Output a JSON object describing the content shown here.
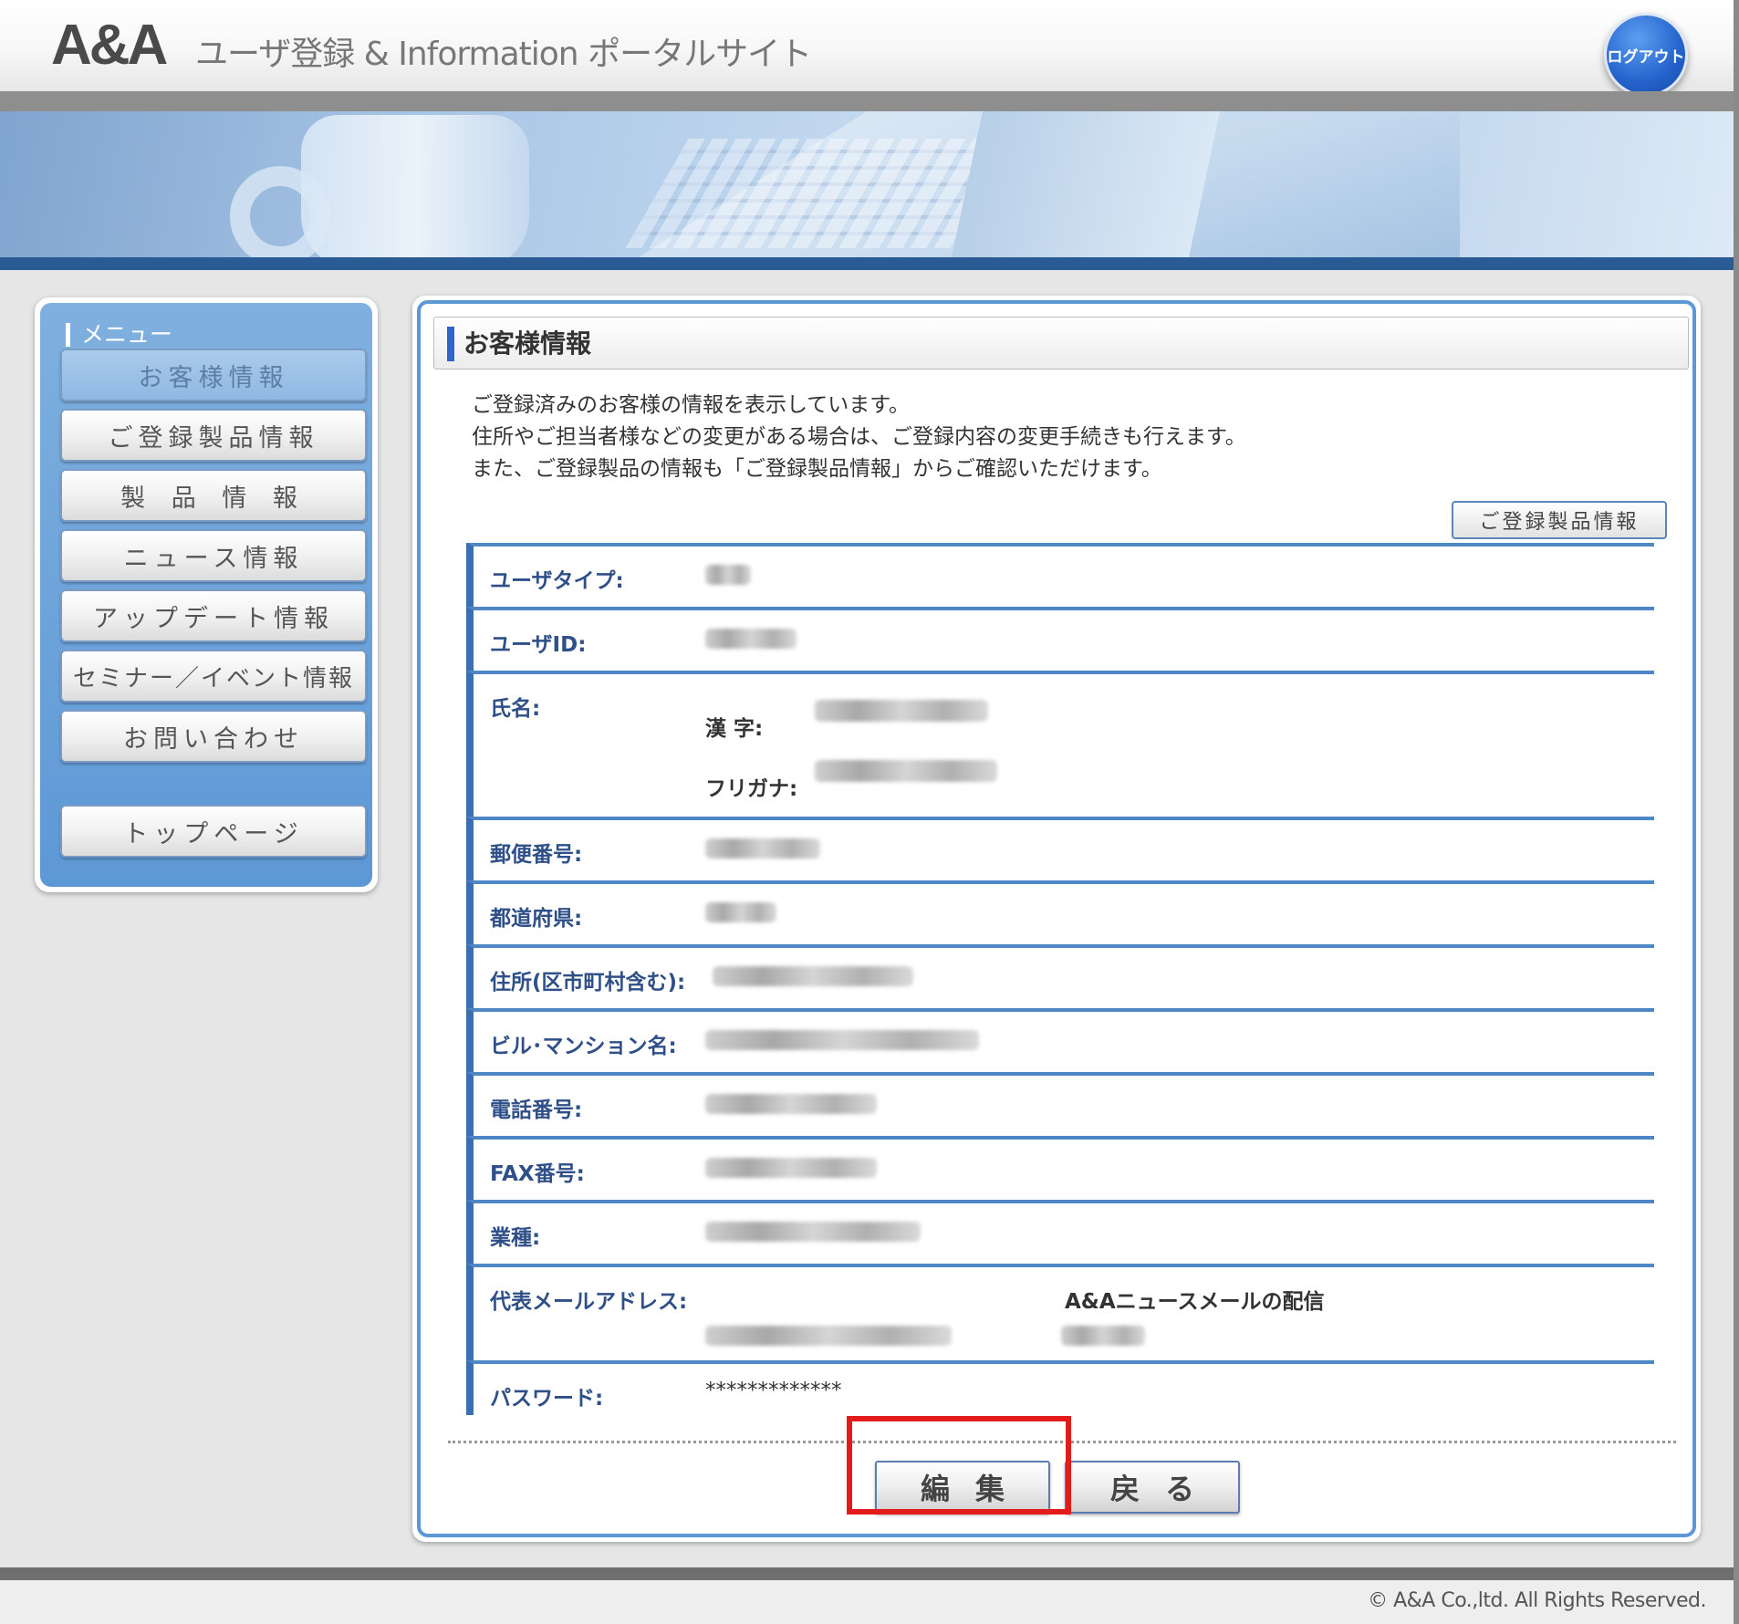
{
  "header": {
    "logo": "A&A",
    "site_title": "ユーザ登録 & Information ポータルサイト",
    "logout_label": "ログアウト"
  },
  "sidebar": {
    "title": "メニュー",
    "items": [
      {
        "label": "お客様情報",
        "active": true
      },
      {
        "label": "ご登録製品情報"
      },
      {
        "label": "製 品 情 報"
      },
      {
        "label": "ニュース情報"
      },
      {
        "label": "アップデート情報"
      },
      {
        "label": "セミナー／イベント情報"
      },
      {
        "label": "お問い合わせ"
      }
    ],
    "top_page": "トップページ"
  },
  "main": {
    "page_title": "お客様情報",
    "intro": [
      "ご登録済みのお客様の情報を表示しています。",
      "住所やご担当者様などの変更がある場合は、ご登録内容の変更手続きも行えます。",
      "また、ご登録製品の情報も「ご登録製品情報」からご確認いただけます。"
    ],
    "registered_products_button": "ご登録製品情報",
    "fields": {
      "user_type": "ユーザタイプ:",
      "user_id": "ユーザID:",
      "name": "氏名:",
      "kanji": "漢 字:",
      "furigana": "フリガナ:",
      "postal_code": "郵便番号:",
      "prefecture": "都道府県:",
      "address": "住所(区市町村含む):",
      "building": "ビル･マンション名:",
      "phone": "電話番号:",
      "fax": "FAX番号:",
      "industry": "業種:",
      "email": "代表メールアドレス:",
      "newsletter": "A&Aニュースメールの配信",
      "password": "パスワード:",
      "password_value": "*************"
    },
    "edit_button": "編集",
    "back_button": "戻る"
  },
  "footer": {
    "copyright": "© A&A Co.,ltd. All Rights Reserved."
  },
  "colors": {
    "accent_blue": "#5d98d6",
    "highlight_red": "#e31b1b",
    "label_blue": "#2e4f88"
  }
}
